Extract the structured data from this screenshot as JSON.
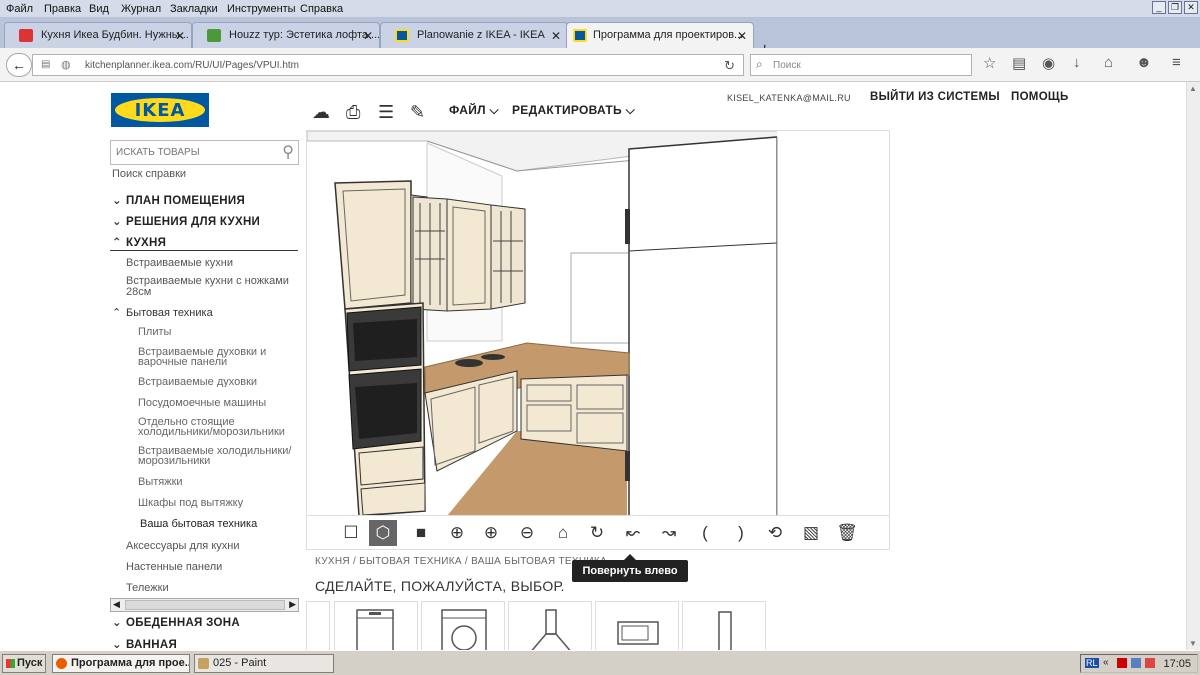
{
  "browser": {
    "menu": [
      "Файл",
      "Правка",
      "Вид",
      "Журнал",
      "Закладки",
      "Инструменты",
      "Справка"
    ],
    "window_controls": [
      "_",
      "❐",
      "✕"
    ],
    "tabs": [
      {
        "title": "Кухня Икеа Будбин. Нужны...",
        "favicon_color": "#d33"
      },
      {
        "title": "Houzz тур: Эстетика лофта ...",
        "favicon_color": "#4a9a3a"
      },
      {
        "title": "Planowanie z IKEA - IKEA",
        "favicon_color": "#0058a3"
      },
      {
        "title": "Программа для проектиров...",
        "favicon_color": "#0058a3"
      }
    ],
    "active_tab": 3,
    "url": "kitchenplanner.ikea.com/RU/UI/Pages/VPUI.htm",
    "search_placeholder": "Поиск"
  },
  "header": {
    "logo_text": "IKEA",
    "email": "KISEL_KATENKA@MAIL.RU",
    "logout": "ВЫЙТИ ИЗ СИСТЕМЫ",
    "help": "ПОМОЩЬ",
    "file_menu": "ФАЙЛ",
    "edit_menu": "РЕДАКТИРОВАТЬ"
  },
  "sidebar": {
    "search_placeholder": "ИСКАТЬ ТОВАРЫ",
    "help_search": "Поиск справки",
    "top_items": [
      {
        "label": "ПЛАН ПОМЕЩЕНИЯ",
        "expanded": false
      },
      {
        "label": "РЕШЕНИЯ ДЛЯ КУХНИ",
        "expanded": false
      },
      {
        "label": "КУХНЯ",
        "expanded": true
      }
    ],
    "kitchen_items": [
      "Встраиваемые кухни",
      "Встраиваемые кухни с ножками 28см"
    ],
    "appliances_label": "Бытовая техника",
    "appliance_items": [
      "Плиты",
      "Встраиваемые духовки и варочные панели",
      "Встраиваемые духовки",
      "Посудомоечные машины",
      "Отдельно стоящие холодильники/морозильники",
      "Встраиваемые холодильники/морозильники",
      "Вытяжки",
      "Шкафы под вытяжку",
      "Ваша бытовая техника"
    ],
    "other_items": [
      "Аксессуары для кухни",
      "Настенные панели",
      "Тележки"
    ],
    "bottom_items": [
      {
        "label": "ОБЕДЕННАЯ ЗОНА"
      },
      {
        "label": "ВАННАЯ"
      }
    ]
  },
  "main": {
    "breadcrumb": "КУХНЯ / БЫТОВАЯ ТЕХНИКА / ВАША БЫТОВАЯ ТЕХНИКА",
    "prompt": "СДЕЛАЙТЕ, ПОЖАЛУЙСТА, ВЫБОР.",
    "tooltip": "Повернуть влево",
    "selected_view": "3d-view"
  },
  "taskbar": {
    "start": "Пуск",
    "tasks": [
      "Программа для прое...",
      "025 - Paint"
    ],
    "tray_lang": "RL",
    "clock": "17:05"
  }
}
